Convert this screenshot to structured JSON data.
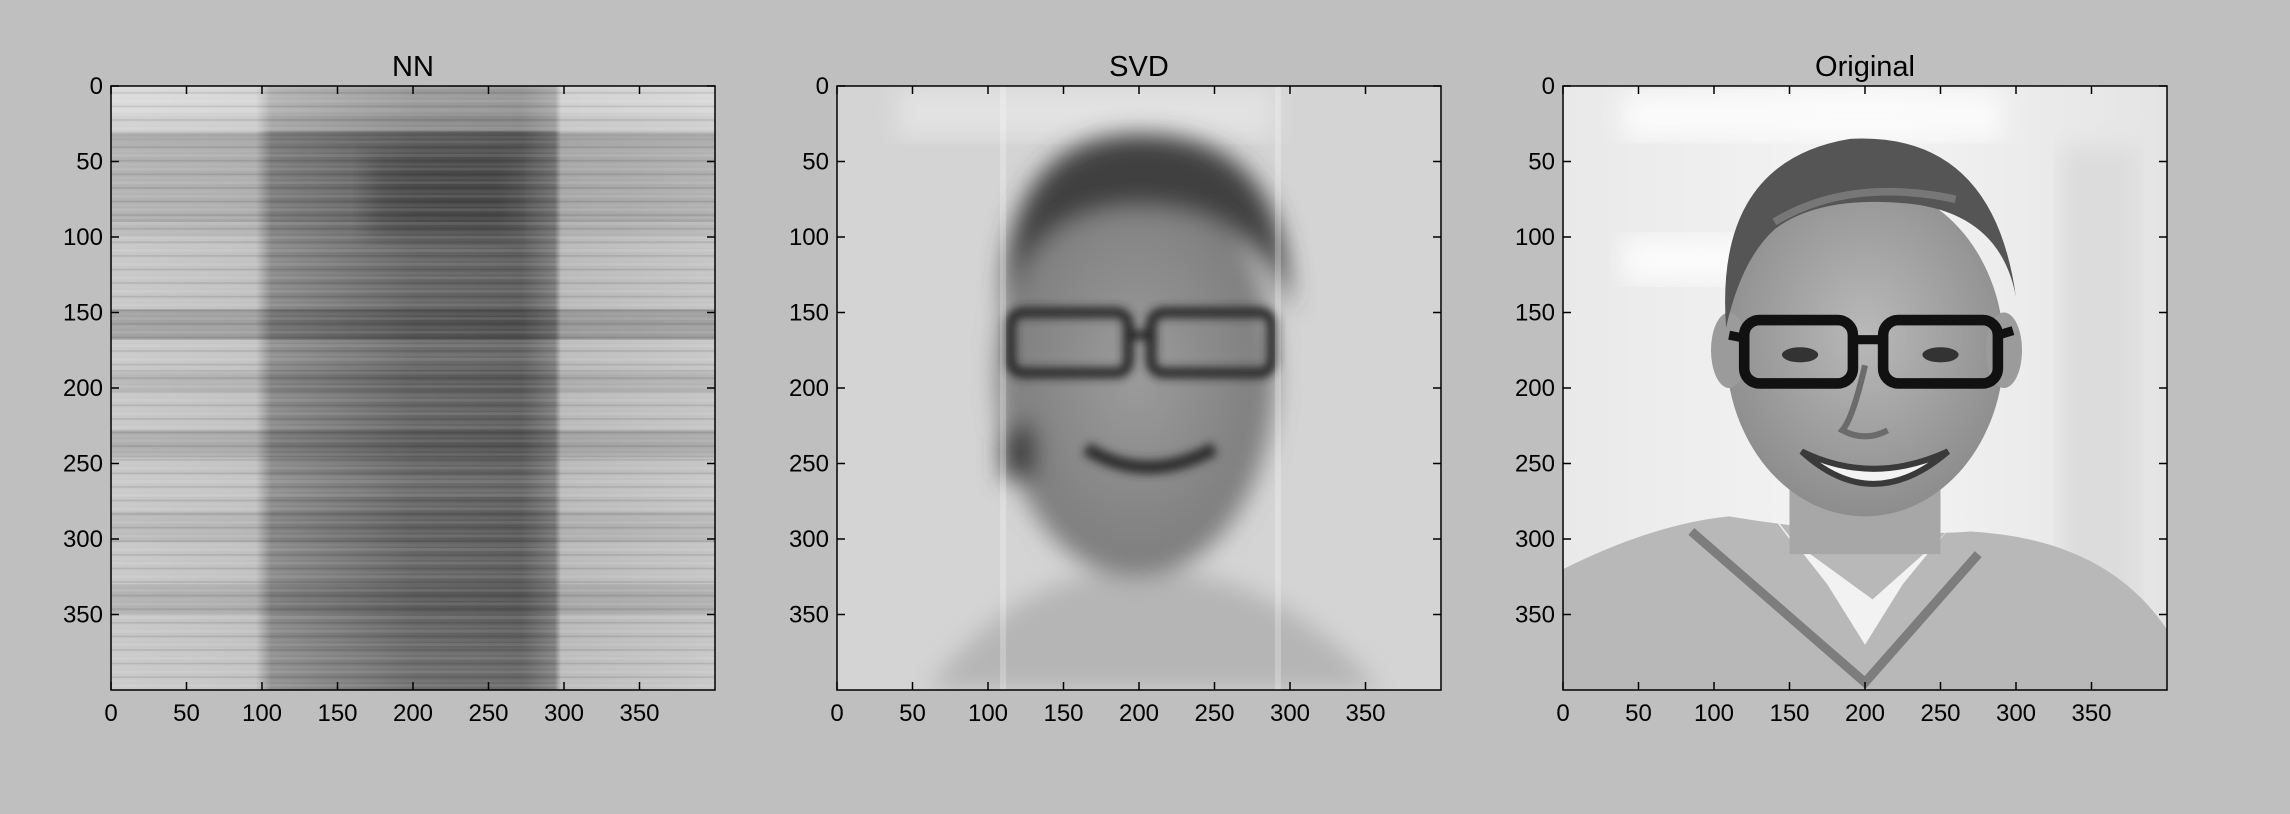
{
  "figure": {
    "background": "#bfbfbf",
    "panels": [
      {
        "title": "NN",
        "content": "nn"
      },
      {
        "title": "SVD",
        "content": "svd"
      },
      {
        "title": "Original",
        "content": "original"
      }
    ]
  },
  "chart_data": [
    {
      "type": "heatmap",
      "title": "NN",
      "colormap": "gray",
      "xlim": [
        0,
        400
      ],
      "ylim": [
        400,
        0
      ],
      "xticks": [
        0,
        50,
        100,
        150,
        200,
        250,
        300,
        350
      ],
      "xtick_labels": [
        "0",
        "50",
        "100",
        "150",
        "200",
        "250",
        "300",
        "350"
      ],
      "yticks": [
        0,
        50,
        100,
        150,
        200,
        250,
        300,
        350
      ],
      "ytick_labels": [
        "0",
        "50",
        "100",
        "150",
        "200",
        "250",
        "300",
        "350"
      ]
    },
    {
      "type": "heatmap",
      "title": "SVD",
      "colormap": "gray",
      "xlim": [
        0,
        400
      ],
      "ylim": [
        400,
        0
      ],
      "xticks": [
        0,
        50,
        100,
        150,
        200,
        250,
        300,
        350
      ],
      "xtick_labels": [
        "0",
        "50",
        "100",
        "150",
        "200",
        "250",
        "300",
        "350"
      ],
      "yticks": [
        0,
        50,
        100,
        150,
        200,
        250,
        300,
        350
      ],
      "ytick_labels": [
        "0",
        "50",
        "100",
        "150",
        "200",
        "250",
        "300",
        "350"
      ]
    },
    {
      "type": "heatmap",
      "title": "Original",
      "colormap": "gray",
      "xlim": [
        0,
        400
      ],
      "ylim": [
        400,
        0
      ],
      "xticks": [
        0,
        50,
        100,
        150,
        200,
        250,
        300,
        350
      ],
      "xtick_labels": [
        "0",
        "50",
        "100",
        "150",
        "200",
        "250",
        "300",
        "350"
      ],
      "yticks": [
        0,
        50,
        100,
        150,
        200,
        250,
        300,
        350
      ],
      "ytick_labels": [
        "0",
        "50",
        "100",
        "150",
        "200",
        "250",
        "300",
        "350"
      ]
    }
  ]
}
